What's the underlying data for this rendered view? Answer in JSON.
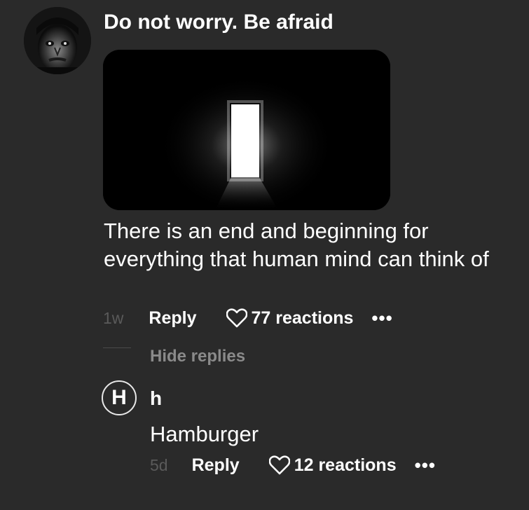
{
  "comment": {
    "author": "Do not worry. Be afraid",
    "body": "There is an end and beginning for everything that human mind can think of",
    "time": "1w",
    "reply_label": "Reply",
    "reactions": "77 reactions",
    "more_icon": "more-dots-icon",
    "heart_icon": "heart-outline-icon",
    "hide_replies_label": "Hide replies"
  },
  "reply": {
    "avatar_letter": "H",
    "author": "h",
    "body": "Hamburger",
    "time": "5d",
    "reply_label": "Reply",
    "reactions": "12 reactions",
    "more_icon": "more-dots-icon",
    "heart_icon": "heart-outline-icon"
  },
  "colors": {
    "background": "#2a2a2a",
    "text": "#ffffff",
    "muted": "#8a8a8a",
    "timestamp": "#5a5a5a"
  }
}
